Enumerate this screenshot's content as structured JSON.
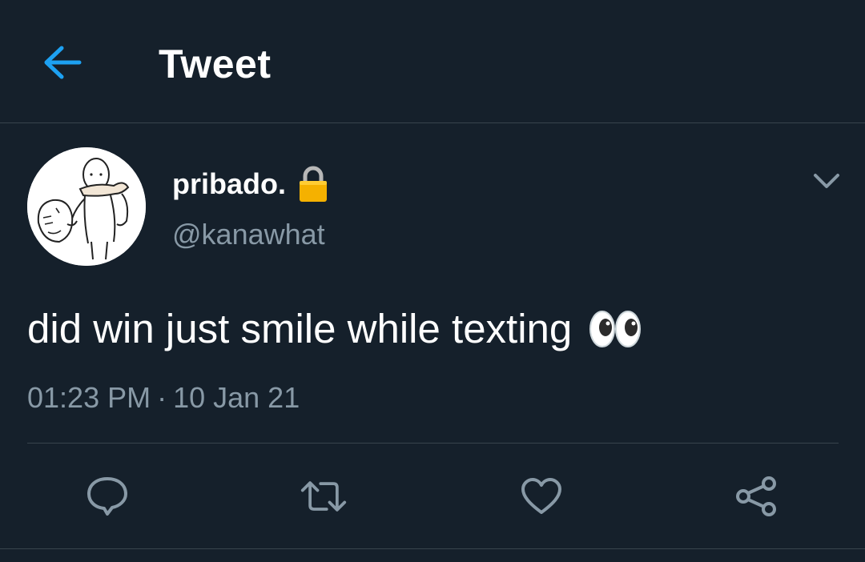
{
  "header": {
    "title": "Tweet",
    "back_icon": "arrow-left-icon"
  },
  "tweet": {
    "author": {
      "display_name": "pribado.",
      "handle": "@kanawhat",
      "protected_icon": "lock-icon",
      "avatar_icon": "avatar-illustration"
    },
    "text": "did win just smile while texting",
    "emoji": "eyes-emoji",
    "time": "01:23 PM",
    "separator": "·",
    "date": "10 Jan 21",
    "more_icon": "chevron-down-icon"
  },
  "actions": [
    {
      "name": "reply",
      "icon": "reply-icon"
    },
    {
      "name": "retweet",
      "icon": "retweet-icon"
    },
    {
      "name": "like",
      "icon": "heart-icon"
    },
    {
      "name": "share",
      "icon": "share-icon"
    }
  ],
  "colors": {
    "background": "#15202b",
    "accent": "#1da1f2",
    "secondary_text": "#8899a6",
    "divider": "#38444d",
    "lock": "#f5b100"
  }
}
